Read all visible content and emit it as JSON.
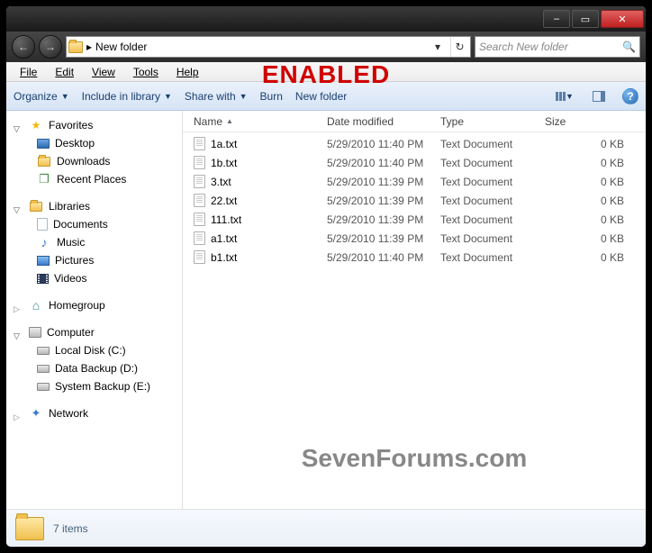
{
  "titlebar": {
    "min": "–",
    "max": "▭",
    "close": "✕"
  },
  "nav": {
    "back": "←",
    "forward": "→",
    "address_sep": "▸",
    "address_text": "New folder",
    "dropdown": "▾",
    "refresh": "↻",
    "search_placeholder": "Search New folder",
    "search_icon": "🔍"
  },
  "menus": {
    "file": "File",
    "edit": "Edit",
    "view": "View",
    "tools": "Tools",
    "help": "Help"
  },
  "overlay": "ENABLED",
  "toolbar": {
    "organize": "Organize",
    "include": "Include in library",
    "share": "Share with",
    "burn": "Burn",
    "newfolder": "New folder",
    "drop": "▼",
    "help": "?"
  },
  "sidebar": {
    "favorites": {
      "label": "Favorites",
      "items": [
        {
          "label": "Desktop",
          "icon": "desktop"
        },
        {
          "label": "Downloads",
          "icon": "downloads"
        },
        {
          "label": "Recent Places",
          "icon": "recent"
        }
      ]
    },
    "libraries": {
      "label": "Libraries",
      "items": [
        {
          "label": "Documents",
          "icon": "doc"
        },
        {
          "label": "Music",
          "icon": "music"
        },
        {
          "label": "Pictures",
          "icon": "pictures"
        },
        {
          "label": "Videos",
          "icon": "videos"
        }
      ]
    },
    "homegroup": {
      "label": "Homegroup"
    },
    "computer": {
      "label": "Computer",
      "items": [
        {
          "label": "Local Disk (C:)",
          "icon": "drive"
        },
        {
          "label": "Data Backup (D:)",
          "icon": "drive"
        },
        {
          "label": "System Backup (E:)",
          "icon": "drive"
        }
      ]
    },
    "network": {
      "label": "Network"
    }
  },
  "columns": {
    "name": "Name",
    "date": "Date modified",
    "type": "Type",
    "size": "Size",
    "sort": "▲"
  },
  "files": [
    {
      "name": "1a.txt",
      "date": "5/29/2010 11:40 PM",
      "type": "Text Document",
      "size": "0 KB"
    },
    {
      "name": "1b.txt",
      "date": "5/29/2010 11:40 PM",
      "type": "Text Document",
      "size": "0 KB"
    },
    {
      "name": "3.txt",
      "date": "5/29/2010 11:39 PM",
      "type": "Text Document",
      "size": "0 KB"
    },
    {
      "name": "22.txt",
      "date": "5/29/2010 11:39 PM",
      "type": "Text Document",
      "size": "0 KB"
    },
    {
      "name": "111.txt",
      "date": "5/29/2010 11:39 PM",
      "type": "Text Document",
      "size": "0 KB"
    },
    {
      "name": "a1.txt",
      "date": "5/29/2010 11:39 PM",
      "type": "Text Document",
      "size": "0 KB"
    },
    {
      "name": "b1.txt",
      "date": "5/29/2010 11:40 PM",
      "type": "Text Document",
      "size": "0 KB"
    }
  ],
  "status": {
    "count": "7 items"
  },
  "watermark": "SevenForums.com"
}
